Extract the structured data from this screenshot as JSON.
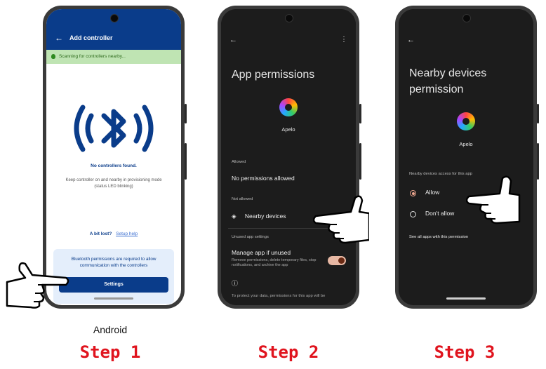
{
  "step1": {
    "header_title": "Add controller",
    "scan_text": "Scanning for controllers nearby...",
    "no_found": "No controllers found.",
    "keep_text_1": "Keep controller on and nearby in provisioning mode",
    "keep_text_2": "(status LED blinking)",
    "lost_label": "A bit lost?",
    "setup_help": "Setup help",
    "perm_text_1": "Bluetooth permissions are required to allow",
    "perm_text_2": "communication with the controllers",
    "settings_button": "Settings",
    "platform": "Android",
    "caption": "Step 1"
  },
  "step2": {
    "title": "App permissions",
    "app_name": "Apelo",
    "allowed_header": "Allowed",
    "no_permissions": "No permissions allowed",
    "not_allowed_header": "Not allowed",
    "nearby_devices": "Nearby devices",
    "unused_header": "Unused app settings",
    "manage_unused": "Manage app if unused",
    "manage_desc": "Remove permissions, delete temporary files, stop notifications, and archive the app",
    "info_text": "To protect your data, permissions for this app will be",
    "caption": "Step 2"
  },
  "step3": {
    "title_1": "Nearby devices",
    "title_2": "permission",
    "app_name": "Apelo",
    "access_header": "Nearby devices access for this app",
    "allow": "Allow",
    "dont_allow": "Don't allow",
    "see_all": "See all apps with this permission",
    "caption": "Step 3"
  },
  "colors": {
    "brand_blue": "#0a3c8a",
    "step_red": "#e0141e",
    "scan_green": "#bfe4b3"
  }
}
